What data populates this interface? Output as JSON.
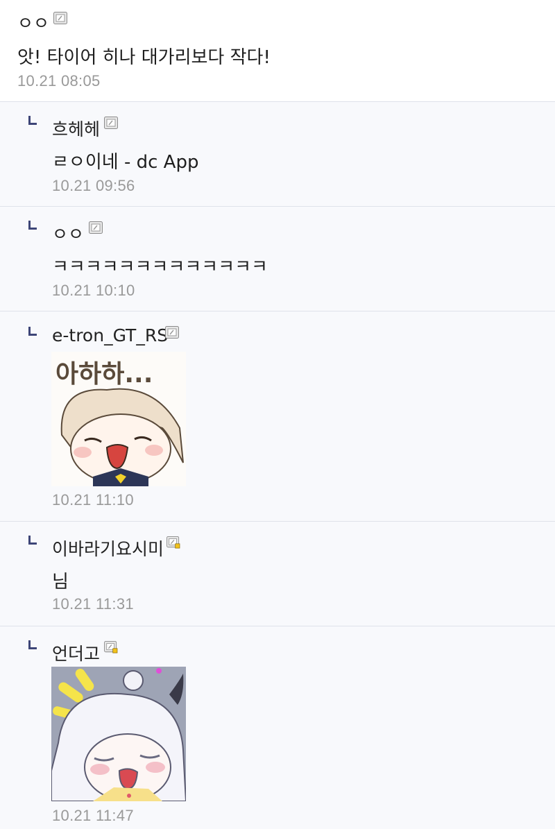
{
  "comments": [
    {
      "nick": "ㅇㅇ",
      "text": "앗! 타이어 히나 대가리보다 작다!",
      "time": "10.21 08:05"
    },
    {
      "nick": "흐헤헤",
      "text": "ㄹㅇ이네 - dc App",
      "time": "10.21 09:56"
    },
    {
      "nick": "ㅇㅇ",
      "text": "ㅋㅋㅋㅋㅋㅋㅋㅋㅋㅋㅋㅋㅋ",
      "time": "10.21 10:10"
    },
    {
      "nick": "e-tron_GT_RS",
      "sticker_text": "아하하...",
      "time": "10.21 11:10"
    },
    {
      "nick": "이바라기요시미",
      "text": "님",
      "time": "10.21 11:31"
    },
    {
      "nick": "언더고",
      "time": "10.21 11:47"
    }
  ],
  "colors": {
    "reply_bg": "#f8f9fc",
    "divider": "#dfe2ea",
    "reply_mark": "#3d4577",
    "timestamp": "#999999",
    "fixed_member_badge": "#f2c21b"
  },
  "icons": {
    "reply_mark": "reply-arrow-icon",
    "gallog": "gallog-icon",
    "fixed_member": "fixed-member-gallog-icon"
  }
}
